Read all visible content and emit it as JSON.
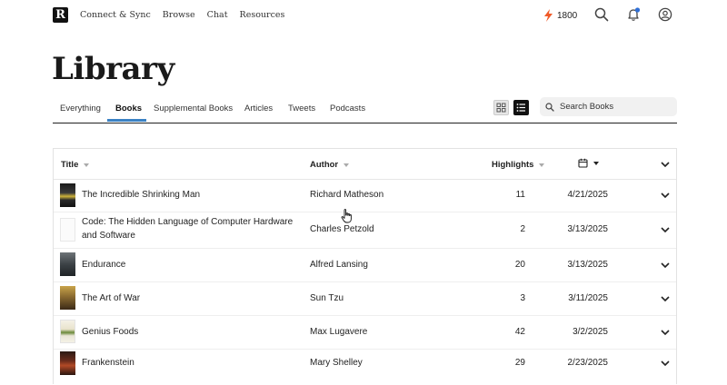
{
  "nav": {
    "logo": "R",
    "links": [
      "Connect & Sync",
      "Browse",
      "Chat",
      "Resources"
    ],
    "points": "1800"
  },
  "page": {
    "title": "Library"
  },
  "tabs": [
    "Everything",
    "Books",
    "Supplemental Books",
    "Articles",
    "Tweets",
    "Podcasts"
  ],
  "active_tab": "Books",
  "search": {
    "placeholder": "Search Books"
  },
  "table": {
    "headers": {
      "title": "Title",
      "author": "Author",
      "highlights": "Highlights"
    },
    "rows": [
      {
        "title": "The Incredible Shrinking Man",
        "author": "Richard Matheson",
        "highlights": "11",
        "date": "4/21/2025"
      },
      {
        "title": "Code: The Hidden Language of Computer Hardware",
        "title2": "and Software",
        "author": "Charles Petzold",
        "highlights": "2",
        "date": "3/13/2025"
      },
      {
        "title": "Endurance",
        "author": "Alfred Lansing",
        "highlights": "20",
        "date": "3/13/2025"
      },
      {
        "title": "The Art of War",
        "author": "Sun Tzu",
        "highlights": "3",
        "date": "3/11/2025"
      },
      {
        "title": "Genius Foods",
        "author": "Max Lugavere",
        "highlights": "42",
        "date": "3/2/2025"
      },
      {
        "title": "Frankenstein",
        "author": "Mary Shelley",
        "highlights": "29",
        "date": "2/23/2025"
      }
    ]
  },
  "colors": {
    "accent": "#3b82c4",
    "bolt": "#f05a28",
    "bell_dot": "#2f6fd6"
  },
  "icons": [
    "bolt-icon",
    "search-icon",
    "bell-icon",
    "user-icon",
    "grid-view-icon",
    "list-view-icon",
    "calendar-icon",
    "chevron-down-icon",
    "hand-cursor-icon"
  ]
}
